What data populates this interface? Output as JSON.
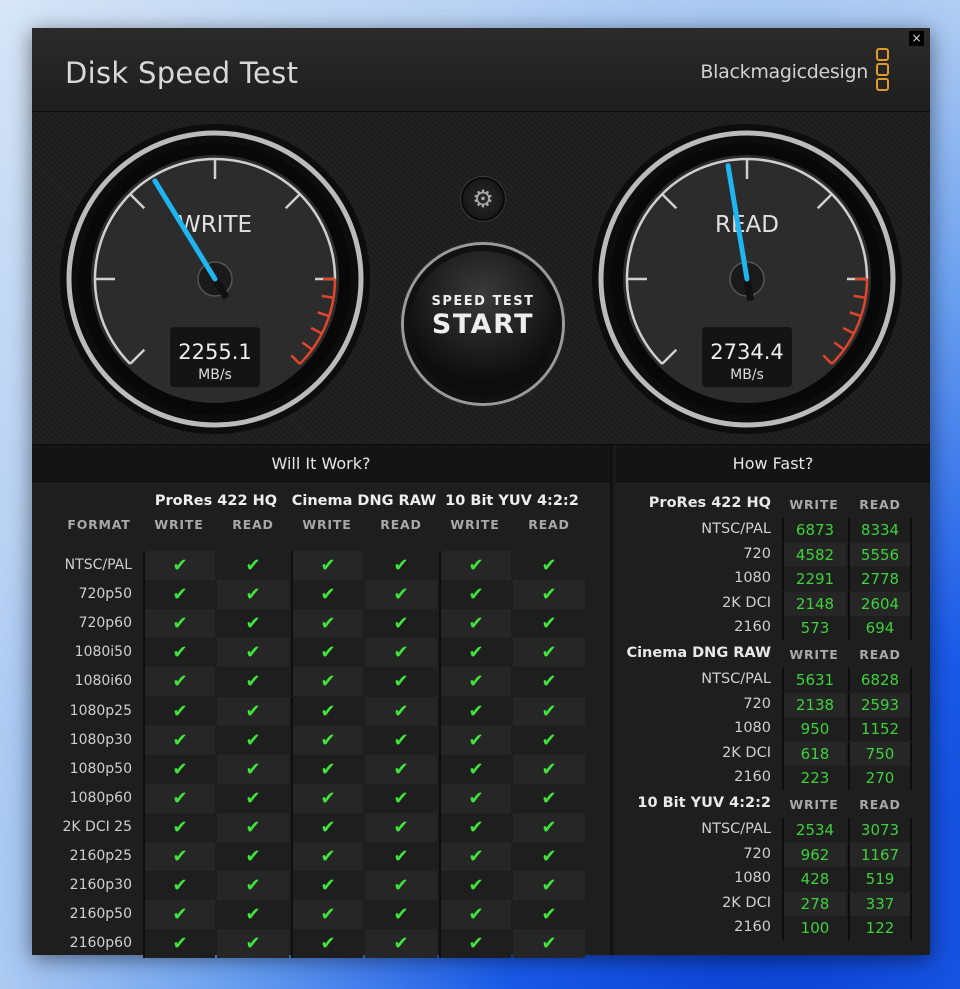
{
  "app": {
    "title": "Disk Speed Test",
    "brand": "Blackmagicdesign",
    "close_label": "×"
  },
  "gauges": {
    "write": {
      "label": "WRITE",
      "value": "2255.1",
      "unit": "MB/s",
      "mbps": 2255.1
    },
    "read": {
      "label": "READ",
      "value": "2734.4",
      "unit": "MB/s",
      "mbps": 2734.4
    },
    "needle_color": "#1fb5f0",
    "redline_color": "#e0452e"
  },
  "start_button": {
    "line1": "SPEED TEST",
    "line2": "START"
  },
  "settings": {
    "icon": "gear-icon"
  },
  "will_it_work": {
    "title": "Will It Work?",
    "format_header": "FORMAT",
    "groups": [
      "ProRes 422 HQ",
      "Cinema DNG RAW",
      "10 Bit YUV 4:2:2"
    ],
    "sub": [
      "WRITE",
      "READ"
    ],
    "formats": [
      "NTSC/PAL",
      "720p50",
      "720p60",
      "1080i50",
      "1080i60",
      "1080p25",
      "1080p30",
      "1080p50",
      "1080p60",
      "2K DCI 25",
      "2160p25",
      "2160p30",
      "2160p50",
      "2160p60"
    ],
    "check": "✔",
    "all_pass": true
  },
  "how_fast": {
    "title": "How Fast?",
    "write_label": "WRITE",
    "read_label": "READ",
    "sections": [
      {
        "name": "ProRes 422 HQ",
        "rows": [
          {
            "f": "NTSC/PAL",
            "w": "6873",
            "r": "8334"
          },
          {
            "f": "720",
            "w": "4582",
            "r": "5556"
          },
          {
            "f": "1080",
            "w": "2291",
            "r": "2778"
          },
          {
            "f": "2K DCI",
            "w": "2148",
            "r": "2604"
          },
          {
            "f": "2160",
            "w": "573",
            "r": "694"
          }
        ]
      },
      {
        "name": "Cinema DNG RAW",
        "rows": [
          {
            "f": "NTSC/PAL",
            "w": "5631",
            "r": "6828"
          },
          {
            "f": "720",
            "w": "2138",
            "r": "2593"
          },
          {
            "f": "1080",
            "w": "950",
            "r": "1152"
          },
          {
            "f": "2K DCI",
            "w": "618",
            "r": "750"
          },
          {
            "f": "2160",
            "w": "223",
            "r": "270"
          }
        ]
      },
      {
        "name": "10 Bit YUV 4:2:2",
        "rows": [
          {
            "f": "NTSC/PAL",
            "w": "2534",
            "r": "3073"
          },
          {
            "f": "720",
            "w": "962",
            "r": "1167"
          },
          {
            "f": "1080",
            "w": "428",
            "r": "519"
          },
          {
            "f": "2K DCI",
            "w": "278",
            "r": "337"
          },
          {
            "f": "2160",
            "w": "100",
            "r": "122"
          }
        ]
      }
    ]
  }
}
